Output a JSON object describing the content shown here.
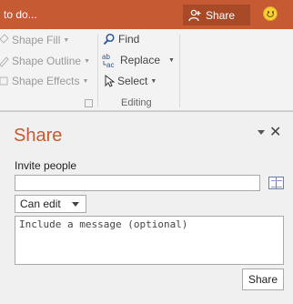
{
  "titlebar": {
    "tell_me": "to do...",
    "share_label": "Share",
    "share_icon": "add-person-icon",
    "feedback_icon": "smiley-icon"
  },
  "ribbon": {
    "drawing": {
      "shape_fill": "Shape Fill",
      "shape_outline": "Shape Outline",
      "shape_effects": "Shape Effects"
    },
    "editing": {
      "find": "Find",
      "replace": "Replace",
      "select": "Select",
      "group_label": "Editing"
    }
  },
  "share_pane": {
    "title": "Share",
    "invite_label": "Invite people",
    "invite_value": "",
    "permission_value": "Can edit",
    "message_placeholder": "Include a message (optional)",
    "share_button": "Share"
  },
  "colors": {
    "accent": "#c55a33",
    "titlebar": "#c55a33",
    "share_button_bg": "#a84a28"
  }
}
